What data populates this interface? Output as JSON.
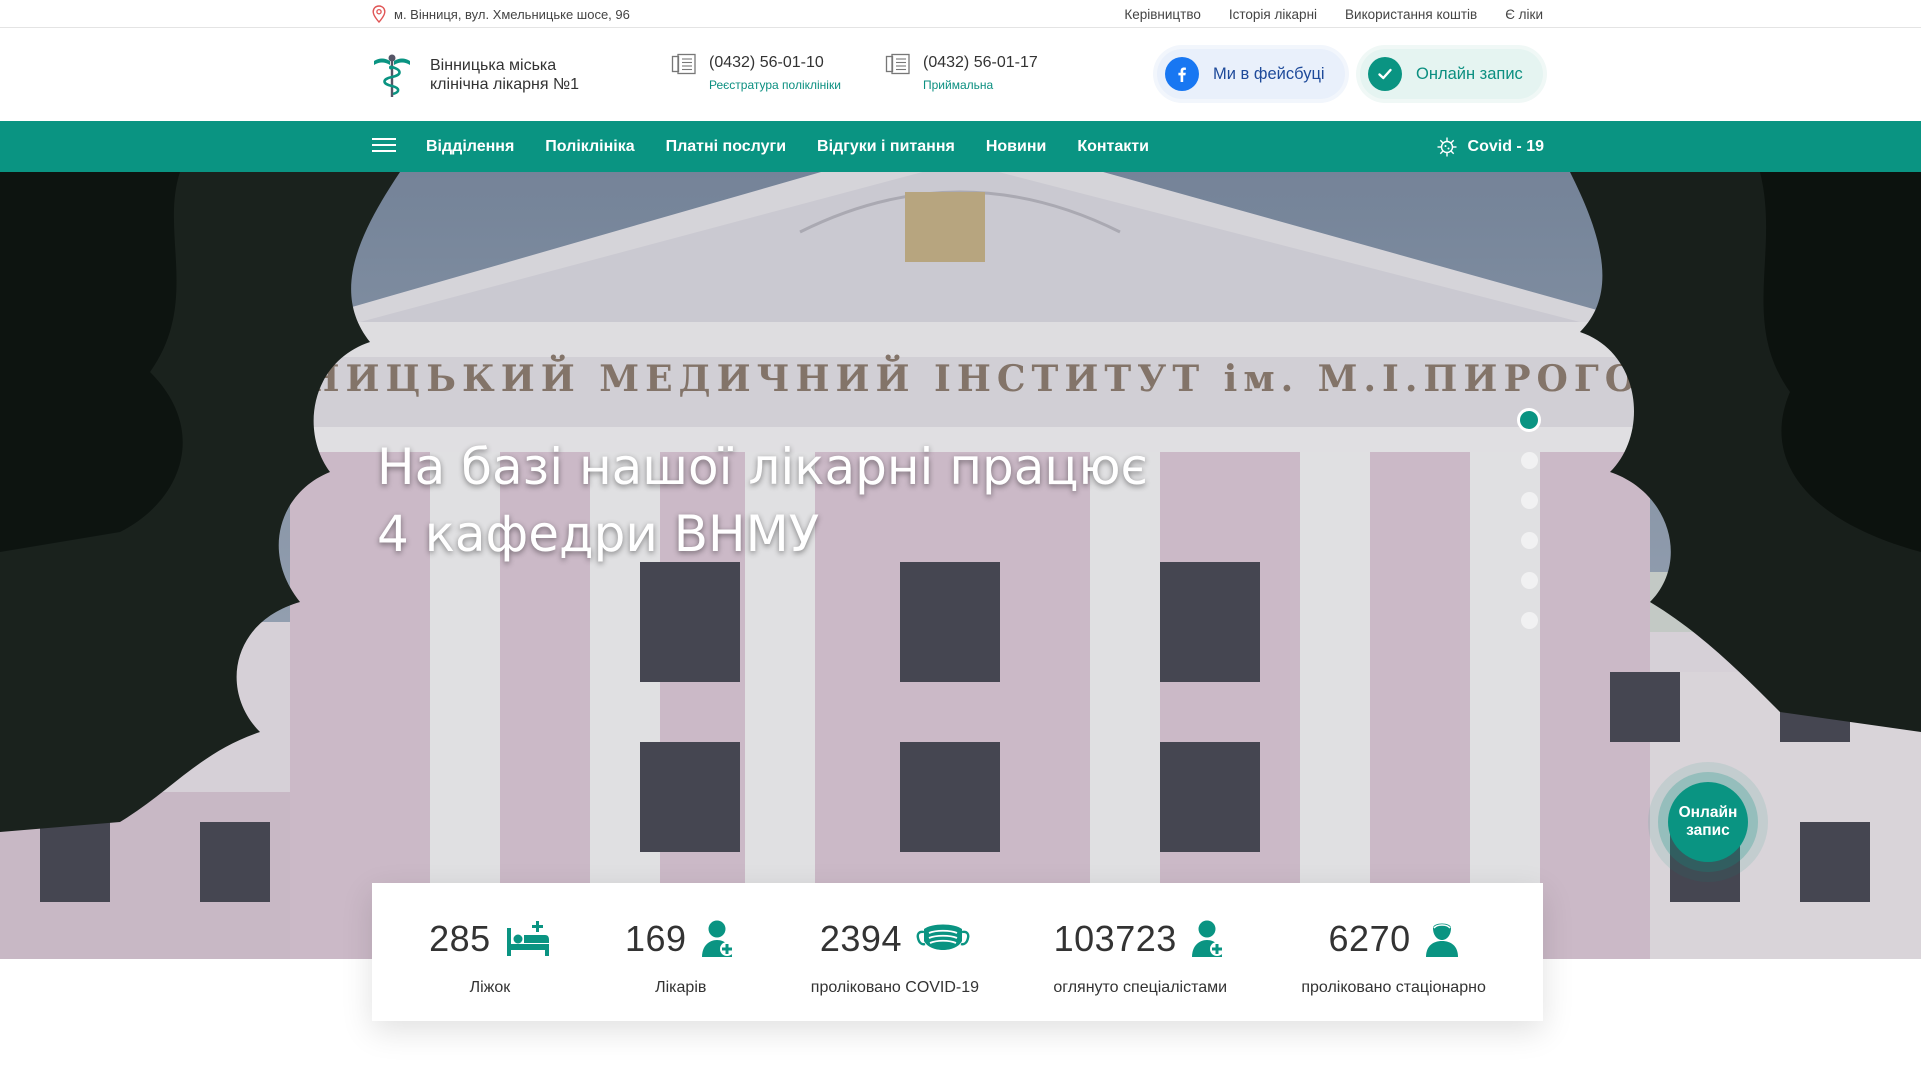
{
  "topbar": {
    "address": "м. Вінниця, вул. Хмельницьке шосе, 96",
    "links": [
      "Керівництво",
      "Історія лікарні",
      "Використання коштів",
      "Є ліки"
    ]
  },
  "header": {
    "logo_line1": "Вінницька міська",
    "logo_line2": "клінічна лікарня №1",
    "phones": [
      {
        "number": "(0432) 56-01-10",
        "label": "Реєстратура поліклініки"
      },
      {
        "number": "(0432) 56-01-17",
        "label": "Приймальна"
      }
    ],
    "facebook_label": "Ми в фейсбуці",
    "online_label": "Онлайн запис"
  },
  "nav": {
    "items": [
      "Відділення",
      "Поліклініка",
      "Платні послуги",
      "Відгуки і питання",
      "Новини",
      "Контакти"
    ],
    "covid_label": "Covid - 19"
  },
  "hero": {
    "title": "На базі нашої лікарні працює\n4 кафедри ВНМУ",
    "facade_inscription": "ВІННИЦЬКИЙ МЕДИЧНИЙ ІНСТИТУТ ім. М.І.ПИРОГОВА",
    "slide_count": 6,
    "active_slide": 1,
    "float_button": "Онлайн\nзапис"
  },
  "stats": [
    {
      "value": "285",
      "label": "Ліжок",
      "icon": "bed-icon"
    },
    {
      "value": "169",
      "label": "Лікарів",
      "icon": "doctor-icon"
    },
    {
      "value": "2394",
      "label": "проліковано COVID-19",
      "icon": "mask-icon"
    },
    {
      "value": "103723",
      "label": "оглянуто спеціалістами",
      "icon": "doctor-icon"
    },
    {
      "value": "6270",
      "label": "проліковано стаціонарно",
      "icon": "patient-icon"
    }
  ],
  "colors": {
    "accent": "#0a9482",
    "facebook": "#1877f2",
    "text": "#333333"
  }
}
